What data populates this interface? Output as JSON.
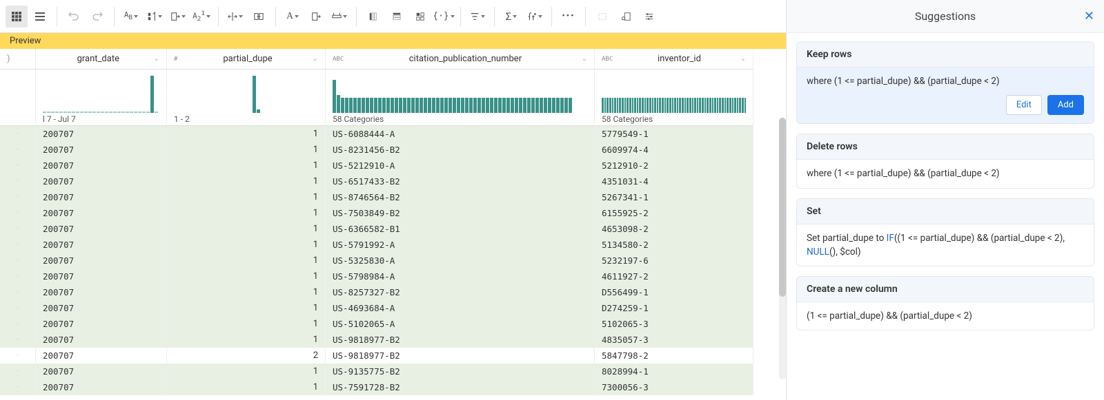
{
  "toolbar": {
    "icons": [
      "grid-view",
      "list-view",
      "undo",
      "redo",
      "column-type",
      "sort",
      "export",
      "rename",
      "split-h",
      "merge",
      "text-format",
      "align",
      "distribute",
      "pivot-col",
      "pivot-row",
      "pivot-both",
      "braces",
      "filter",
      "sum",
      "function",
      "more",
      "rect-select",
      "query",
      "sliders"
    ]
  },
  "preview_label": "Preview",
  "columns": [
    {
      "name": "",
      "type": "",
      "hist_label": ""
    },
    {
      "name": "grant_date",
      "type": "",
      "hist_label": "l 7 - Jul 7"
    },
    {
      "name": "partial_dupe",
      "type": "#",
      "hist_label": "1 - 2"
    },
    {
      "name": "citation_publication_number",
      "type": "ABC",
      "hist_label": "58 Categories"
    },
    {
      "name": "inventor_id",
      "type": "ABC",
      "hist_label": "58 Categories"
    }
  ],
  "rows": [
    {
      "mk": "·",
      "grant_date": "200707",
      "partial_dupe": "1",
      "citation": "US-6088444-A",
      "inventor": "5779549-1",
      "hl": true
    },
    {
      "mk": "·",
      "grant_date": "200707",
      "partial_dupe": "1",
      "citation": "US-8231456-B2",
      "inventor": "6609974-4",
      "hl": true
    },
    {
      "mk": "·",
      "grant_date": "200707",
      "partial_dupe": "1",
      "citation": "US-5212910-A",
      "inventor": "5212910-2",
      "hl": true
    },
    {
      "mk": "·",
      "grant_date": "200707",
      "partial_dupe": "1",
      "citation": "US-6517433-B2",
      "inventor": "4351031-4",
      "hl": true
    },
    {
      "mk": "·",
      "grant_date": "200707",
      "partial_dupe": "1",
      "citation": "US-8746564-B2",
      "inventor": "5267341-1",
      "hl": true
    },
    {
      "mk": "·",
      "grant_date": "200707",
      "partial_dupe": "1",
      "citation": "US-7503849-B2",
      "inventor": "6155925-2",
      "hl": true
    },
    {
      "mk": "·",
      "grant_date": "200707",
      "partial_dupe": "1",
      "citation": "US-6366582-B1",
      "inventor": "4653098-2",
      "hl": true
    },
    {
      "mk": "·",
      "grant_date": "200707",
      "partial_dupe": "1",
      "citation": "US-5791992-A",
      "inventor": "5134580-2",
      "hl": true
    },
    {
      "mk": "·",
      "grant_date": "200707",
      "partial_dupe": "1",
      "citation": "US-5325830-A",
      "inventor": "5232197-6",
      "hl": true
    },
    {
      "mk": "·",
      "grant_date": "200707",
      "partial_dupe": "1",
      "citation": "US-5798984-A",
      "inventor": "4611927-2",
      "hl": true
    },
    {
      "mk": "·",
      "grant_date": "200707",
      "partial_dupe": "1",
      "citation": "US-8257327-B2",
      "inventor": "D556499-1",
      "hl": true
    },
    {
      "mk": "·",
      "grant_date": "200707",
      "partial_dupe": "1",
      "citation": "US-4693684-A",
      "inventor": "D274259-1",
      "hl": true
    },
    {
      "mk": "·",
      "grant_date": "200707",
      "partial_dupe": "1",
      "citation": "US-5102065-A",
      "inventor": "5102065-3",
      "hl": true
    },
    {
      "mk": "·",
      "grant_date": "200707",
      "partial_dupe": "1",
      "citation": "US-9818977-B2",
      "inventor": "4835057-3",
      "hl": true
    },
    {
      "mk": "·",
      "grant_date": "200707",
      "partial_dupe": "2",
      "citation": "US-9818977-B2",
      "inventor": "5847798-2",
      "hl": false
    },
    {
      "mk": "·",
      "grant_date": "200707",
      "partial_dupe": "1",
      "citation": "US-9135775-B2",
      "inventor": "8028994-1",
      "hl": true
    },
    {
      "mk": "·",
      "grant_date": "200707",
      "partial_dupe": "1",
      "citation": "US-7591728-B2",
      "inventor": "7300056-3",
      "hl": true
    }
  ],
  "sidebar": {
    "title": "Suggestions",
    "cards": [
      {
        "title": "Keep rows",
        "body_plain": "where (1 <= partial_dupe) && (partial_dupe < 2)",
        "highlight": true,
        "edit_label": "Edit",
        "add_label": "Add"
      },
      {
        "title": "Delete rows",
        "body_plain": "where (1 <= partial_dupe) && (partial_dupe < 2)"
      },
      {
        "title": "Set",
        "body_prefix": "Set partial_dupe to ",
        "kw1": "IF",
        "body_mid": "((1 <= partial_dupe) && (partial_dupe < 2), ",
        "kw2": "NULL",
        "body_suffix": "(), $col)"
      },
      {
        "title": "Create a new column",
        "body_plain": "(1 <= partial_dupe) && (partial_dupe < 2)"
      }
    ]
  }
}
